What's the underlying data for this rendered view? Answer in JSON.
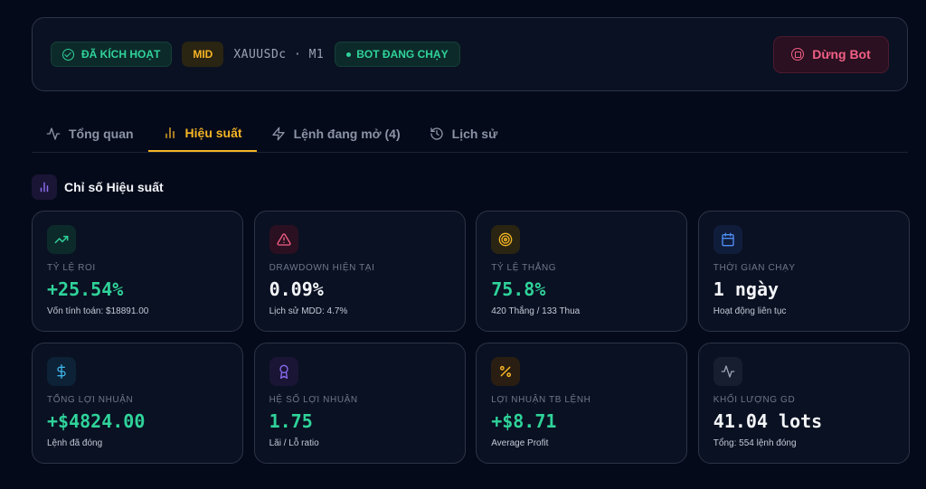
{
  "status": {
    "activated_label": "ĐÃ KÍCH HOẠT",
    "mode_label": "MID",
    "symbol": "XAUUSDc · M1",
    "running_label": "BOT ĐANG CHẠY",
    "stop_button": "Dừng Bot"
  },
  "tabs": [
    {
      "label": "Tổng quan",
      "icon": "activity-icon",
      "active": false
    },
    {
      "label": "Hiệu suất",
      "icon": "bar-chart-icon",
      "active": true
    },
    {
      "label": "Lệnh đang mở (4)",
      "icon": "zap-icon",
      "active": false
    },
    {
      "label": "Lịch sử",
      "icon": "history-icon",
      "active": false
    }
  ],
  "section": {
    "title": "Chỉ số Hiệu suất"
  },
  "metrics": [
    {
      "label": "TỶ LỆ ROI",
      "value": "+25.54%",
      "sub": "Vốn tính toán: $18891.00",
      "icon": "trending-up-icon",
      "color": "#2fd39a"
    },
    {
      "label": "DRAWDOWN HIỆN TẠI",
      "value": "0.09%",
      "sub": "Lịch sử MDD: 4.7%",
      "icon": "warning-icon",
      "color": "#f3f5f9"
    },
    {
      "label": "TỶ LỆ THẮNG",
      "value": "75.8%",
      "sub": "420 Thắng / 133 Thua",
      "icon": "target-icon",
      "color": "#2fd39a"
    },
    {
      "label": "THỜI GIAN CHẠY",
      "value": "1 ngày",
      "sub": "Hoạt động liên tục",
      "icon": "calendar-icon",
      "color": "#f3f5f9"
    },
    {
      "label": "TỔNG LỢI NHUẬN",
      "value": "+$4824.00",
      "sub": "Lệnh đã đóng",
      "icon": "dollar-icon",
      "color": "#2fd39a"
    },
    {
      "label": "HỆ SỐ LỢI NHUẬN",
      "value": "1.75",
      "sub": "Lãi / Lỗ ratio",
      "icon": "award-icon",
      "color": "#2fd39a"
    },
    {
      "label": "LỢI NHUẬN TB LỆNH",
      "value": "+$8.71",
      "sub": "Average Profit",
      "icon": "percent-icon",
      "color": "#2fd39a"
    },
    {
      "label": "KHỐI LƯỢNG GD",
      "value": "41.04 lots",
      "sub": "Tổng: 554 lệnh đóng",
      "icon": "activity-icon",
      "color": "#f3f5f9"
    }
  ]
}
